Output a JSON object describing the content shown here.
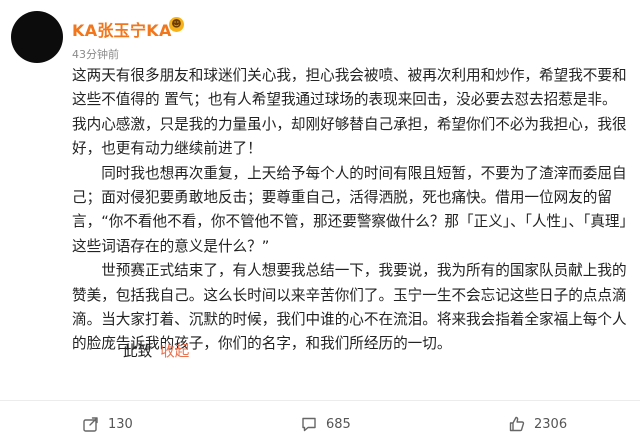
{
  "post": {
    "author": "KA张玉宁KA",
    "author_badge_icon": "grinning-emoji-icon",
    "time": "43分钟前",
    "paragraphs": [
      "这两天有很多朋友和球迷们关心我，担心我会被喷、被再次利用和炒作，希望我不要和这些不值得的 置气；也有人希望我通过球场的表现来回击，没必要去怼去招惹是非。我内心感激，只是我的力量虽小，却刚好够替自己承担，希望你们不必为我担心，我很好，也更有动力继续前进了！",
      "同时我也想再次重复，上天给予每个人的时间有限且短暂，不要为了渣滓而委屈自己；面对侵犯要勇敢地反击；要尊重自己，活得洒脱，死也痛快。借用一位网友的留言，“你不看他不看，你不管他不管，那还要警察做什么？那「正义」、「人性」、「真理」这些词语存在的意义是什么？”",
      "世预赛正式结束了，有人想要我总结一下，我要说，我为所有的国家队员献上我的赞美，包括我自己。这么长时间以来辛苦你们了。玉宁一生不会忘记这些日子的点点滴滴。当大家打着、沉默的时候，我们中谁的心不在流泪。将来我会指着全家福上每个人的脸庞告诉我的孩子，你们的名字，和我们所经历的一切。"
    ],
    "closing": "此致",
    "collapse_label": "收起"
  },
  "actions": {
    "share_icon": "share-icon",
    "share_count": "130",
    "comment_icon": "comment-icon",
    "comment_count": "685",
    "like_icon": "thumbs-up-icon",
    "like_count": "2306"
  },
  "colors": {
    "author_name": "#f2761b",
    "collapse_link": "#eb7350",
    "text": "#222222",
    "meta": "#8a8a8a"
  }
}
